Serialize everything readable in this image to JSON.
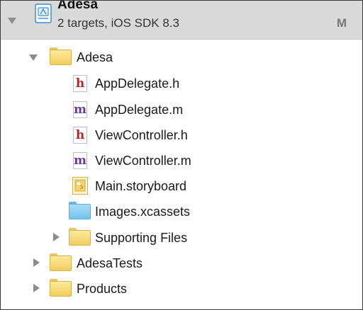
{
  "project": {
    "name": "Adesa",
    "subtitle": "2 targets, iOS SDK 8.3",
    "badge": "M"
  },
  "tree": {
    "group_adesa": {
      "label": "Adesa"
    },
    "files": {
      "appdelegate_h": {
        "label": "AppDelegate.h",
        "glyph": "h"
      },
      "appdelegate_m": {
        "label": "AppDelegate.m",
        "glyph": "m"
      },
      "viewcontroller_h": {
        "label": "ViewController.h",
        "glyph": "h"
      },
      "viewcontroller_m": {
        "label": "ViewController.m",
        "glyph": "m"
      },
      "main_storyboard": {
        "label": "Main.storyboard"
      },
      "images_xcassets": {
        "label": "Images.xcassets"
      }
    },
    "supporting_files": {
      "label": "Supporting Files"
    },
    "adesa_tests": {
      "label": "AdesaTests"
    },
    "products": {
      "label": "Products"
    }
  },
  "colors": {
    "header_background": "#d9d9d9",
    "folder_yellow": "#f2cd5e",
    "folder_blue": "#72c3ef",
    "header_file_glyph": "#b3262d",
    "impl_file_glyph": "#6a3a99"
  },
  "icons": {
    "project": "xcode-project-icon",
    "folder": "folder-icon",
    "asset_catalog": "asset-catalog-folder-icon",
    "header_file": "header-file-icon",
    "implementation_file": "implementation-file-icon",
    "storyboard": "storyboard-icon"
  }
}
